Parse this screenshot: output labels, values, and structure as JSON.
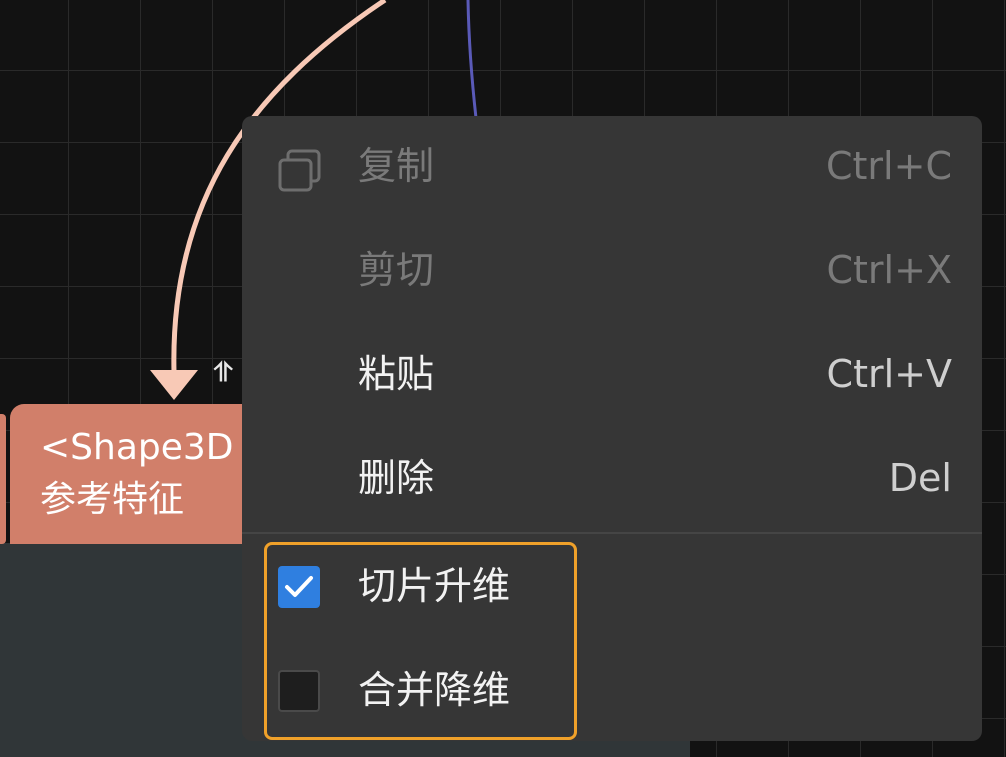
{
  "canvas": {
    "node": {
      "title": "<Shape3D",
      "subtitle": "参考特征",
      "color": "#d17f6a"
    },
    "port_indicator": "⥣",
    "connection_colors": {
      "incoming": "#f8c9b6",
      "blue_link": "#5a5ab8"
    }
  },
  "context_menu": {
    "items": [
      {
        "label": "复制",
        "shortcut": "Ctrl+C",
        "enabled": false,
        "icon": "copy-icon"
      },
      {
        "label": "剪切",
        "shortcut": "Ctrl+X",
        "enabled": false
      },
      {
        "label": "粘贴",
        "shortcut": "Ctrl+V",
        "enabled": true
      },
      {
        "label": "删除",
        "shortcut": "Del",
        "enabled": true
      }
    ],
    "checks": [
      {
        "label": "切片升维",
        "checked": true
      },
      {
        "label": "合并降维",
        "checked": false
      }
    ],
    "highlight_color": "#f0a12a",
    "check_color": "#2f7fe0"
  }
}
